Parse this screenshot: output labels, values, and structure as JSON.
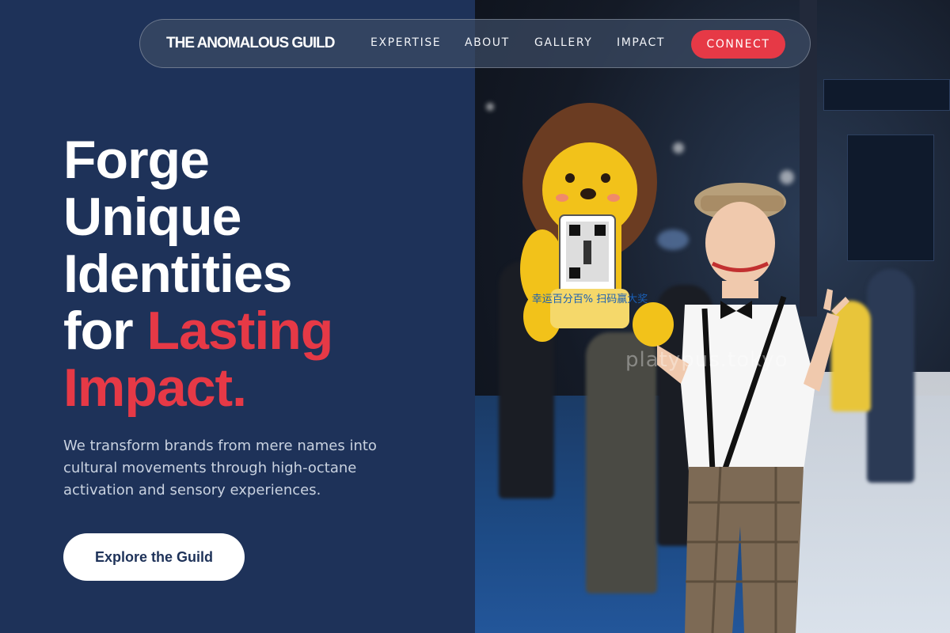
{
  "brand": "THE ANOMALOUS GUILD",
  "nav": {
    "links": [
      "EXPERTISE",
      "ABOUT",
      "GALLERY",
      "IMPACT"
    ],
    "cta": "CONNECT"
  },
  "hero": {
    "line1": "Forge",
    "line2": "Unique",
    "line3": "Identities",
    "line4_plain": "for ",
    "line4_accent": "Lasting",
    "line5_accent": "Impact.",
    "subtext": "We transform brands from mere names into cultural movements through high-octane activation and sensory experiences.",
    "button": "Explore the Guild"
  },
  "photo": {
    "sign_text": "幸运百分百% 扫码赢大奖",
    "watermark": "platypus.tokyo"
  },
  "colors": {
    "navy": "#1e3259",
    "accent": "#e63946",
    "white": "#ffffff"
  }
}
